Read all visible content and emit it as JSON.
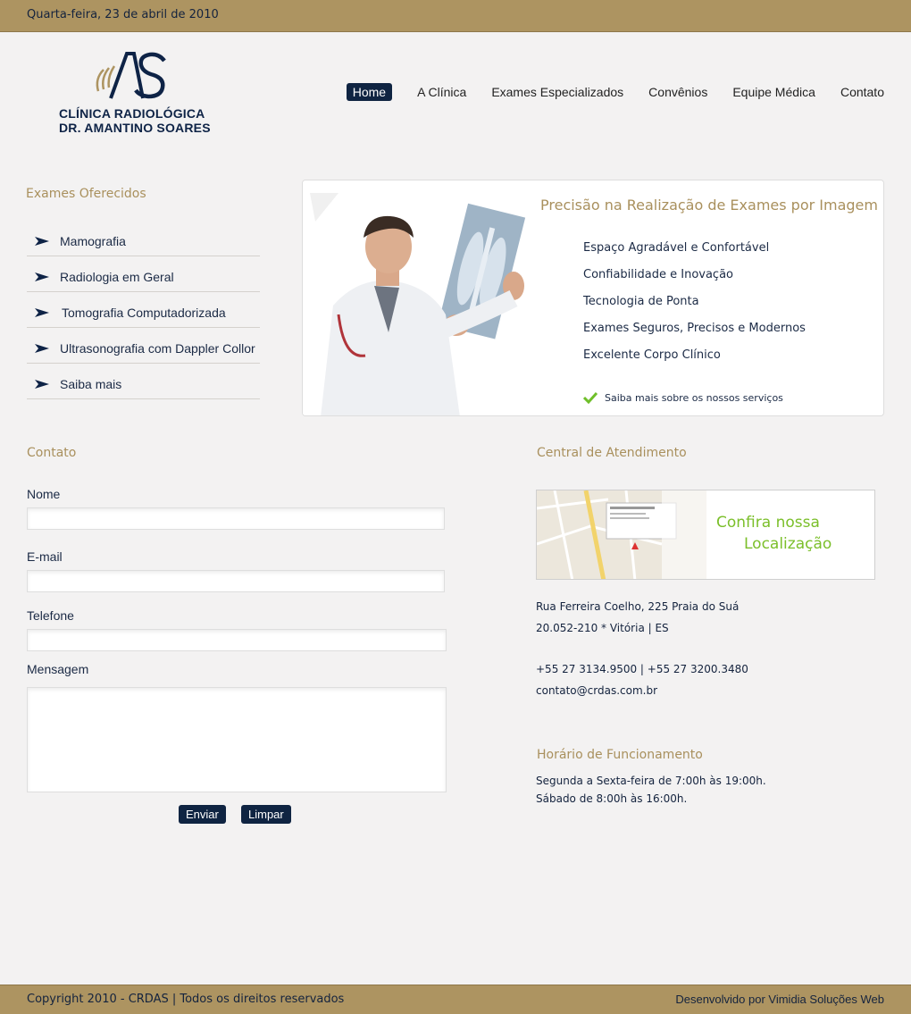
{
  "header": {
    "date": "Quarta-feira, 23 de abril de 2010"
  },
  "logo": {
    "monogram": "AS",
    "line1": "CLÍNICA  RADIOLÓGICA",
    "line2": "DR. AMANTINO SOARES"
  },
  "nav": {
    "items": [
      {
        "label": "Home",
        "active": true
      },
      {
        "label": "A Clínica"
      },
      {
        "label": "Exames Especializados"
      },
      {
        "label": "Convênios"
      },
      {
        "label": "Equipe Médica"
      },
      {
        "label": "Contato"
      }
    ]
  },
  "exams": {
    "title": "Exames Oferecidos",
    "items": [
      {
        "label": "Mamografia"
      },
      {
        "label": "Radiologia em Geral"
      },
      {
        "label": "Tomografia Computadorizada"
      },
      {
        "label": "Ultrasonografia com Dappler Collor"
      },
      {
        "label": "Saiba mais"
      }
    ]
  },
  "banner": {
    "headline": "Precisão na Realização de Exames por Imagem",
    "features": [
      "Espaço Agradável e Confortável",
      "Confiabilidade e Inovação",
      "Tecnologia de Ponta",
      "Exames Seguros, Precisos e Modernos",
      "Excelente Corpo Clínico"
    ],
    "more_link": "Saiba mais sobre os nossos serviços"
  },
  "contact_form": {
    "title": "Contato",
    "name_label": "Nome",
    "email_label": "E-mail",
    "phone_label": "Telefone",
    "message_label": "Mensagem",
    "name_value": "",
    "email_value": "",
    "phone_value": "",
    "message_value": "",
    "send_label": "Enviar",
    "clear_label": "Limpar"
  },
  "service_center": {
    "title": "Central de Atendimento",
    "map_cta_line1": "Confira nossa",
    "map_cta_line2": "Localização",
    "address_line1": "Rua Ferreira Coelho, 225  Praia do Suá",
    "address_line2": "20.052-210 * Vitória | ES",
    "phones": "+55 27 3134.9500  |  +55 27 3200.3480",
    "email": "contato@crdas.com.br"
  },
  "hours": {
    "title": "Horário de Funcionamento",
    "weekdays": "Segunda a Sexta-feira de 7:00h às 19:00h.",
    "saturday": "Sábado de 8:00h às 16:00h."
  },
  "footer": {
    "copyright": "Copyright 2010 - CRDAS | Todos os direitos reservados",
    "developer": "Desenvolvido por Vimidia Soluções Web"
  },
  "colors": {
    "bar": "#ad9461",
    "navy": "#0f2442",
    "gold_text": "#a9905d",
    "green": "#7bbf2a",
    "background": "#f3f2f2"
  }
}
